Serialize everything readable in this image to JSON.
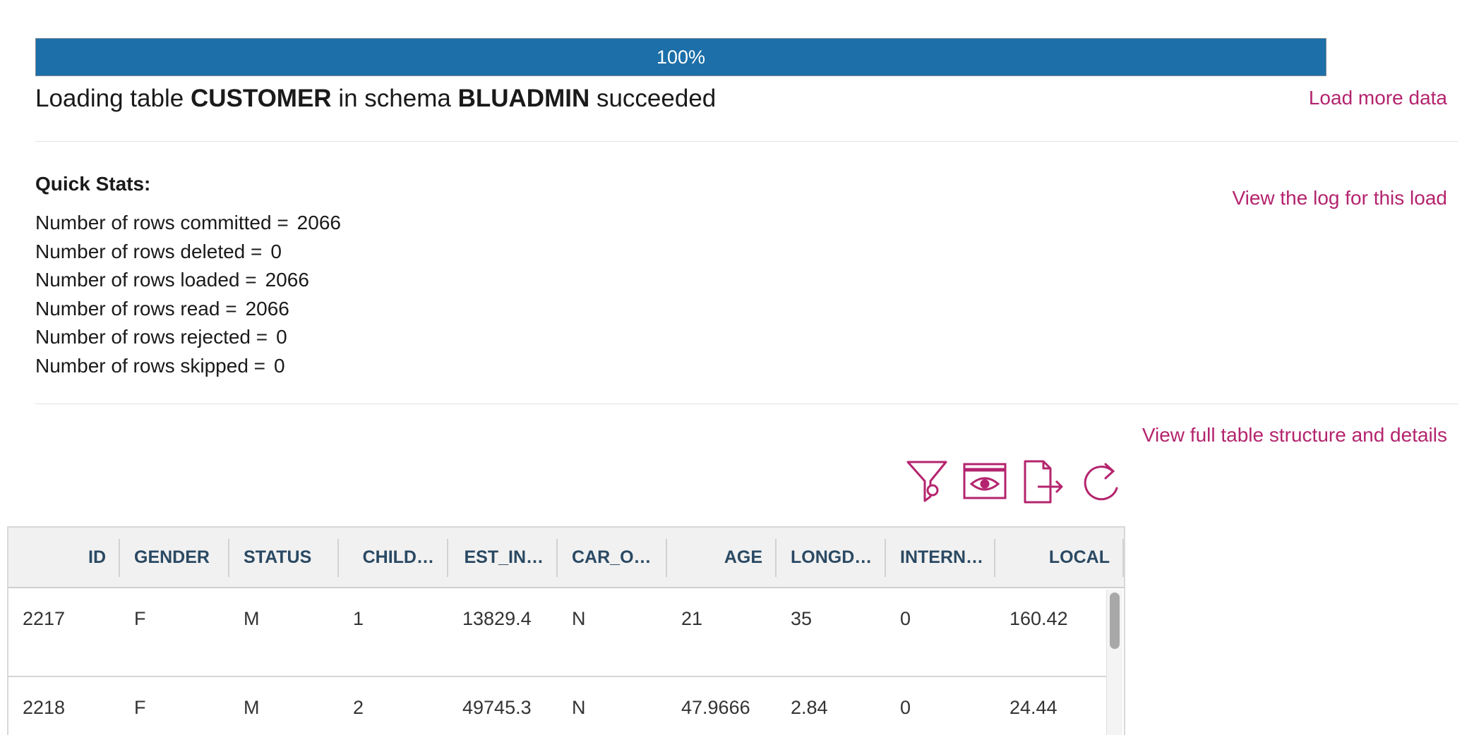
{
  "progress": {
    "fraction": 1.0,
    "label": "100%"
  },
  "title": {
    "prefix": "Loading table",
    "table_name": "CUSTOMER",
    "middle": "in schema",
    "schema_name": "BLUADMIN",
    "suffix": "succeeded"
  },
  "links": {
    "load_more": "Load more data",
    "view_log": "View the log for this load",
    "view_structure": "View full table structure and details"
  },
  "stats": {
    "heading": "Quick Stats:",
    "rows": [
      {
        "label": "Number of rows committed =",
        "value": "2066"
      },
      {
        "label": "Number of rows deleted =",
        "value": "0"
      },
      {
        "label": "Number of rows loaded =",
        "value": "2066"
      },
      {
        "label": "Number of rows read =",
        "value": "2066"
      },
      {
        "label": "Number of rows rejected =",
        "value": "0"
      },
      {
        "label": "Number of rows skipped =",
        "value": "0"
      }
    ]
  },
  "toolbar": {
    "icons": [
      "filter-icon",
      "preview-icon",
      "export-icon",
      "refresh-icon"
    ],
    "accent_color": "#b4246e"
  },
  "table": {
    "columns": [
      "ID",
      "GENDER",
      "STATUS",
      "CHILD…",
      "EST_IN…",
      "CAR_O…",
      "AGE",
      "LONGD…",
      "INTERN…",
      "LOCAL"
    ],
    "rows": [
      [
        "2217",
        "F",
        "M",
        "1",
        "13829.4",
        "N",
        "21",
        "35",
        "0",
        "160.42"
      ],
      [
        "2218",
        "F",
        "M",
        "2",
        "49745.3",
        "N",
        "47.9666",
        "2.84",
        "0",
        "24.44"
      ]
    ]
  },
  "colors": {
    "progress_fill": "#1c6fa8",
    "link": "#b4246e",
    "header_text": "#2a4963"
  }
}
